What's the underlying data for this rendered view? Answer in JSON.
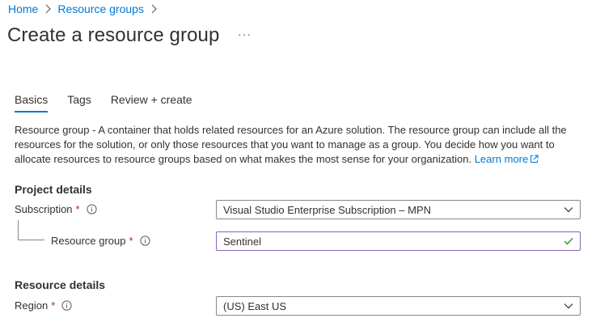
{
  "breadcrumb": {
    "items": [
      "Home",
      "Resource groups"
    ]
  },
  "title": "Create a resource group",
  "more_label": "···",
  "tabs": [
    {
      "label": "Basics",
      "active": true
    },
    {
      "label": "Tags",
      "active": false
    },
    {
      "label": "Review + create",
      "active": false
    }
  ],
  "description": {
    "term": "Resource group",
    "text": " - A container that holds related resources for an Azure solution. The resource group can include all the resources for the solution, or only those resources that you want to manage as a group. You decide how you want to allocate resources to resource groups based on what makes the most sense for your organization. ",
    "link": "Learn more"
  },
  "project_details": {
    "heading": "Project details",
    "subscription": {
      "label": "Subscription",
      "required": "*",
      "value": "Visual Studio Enterprise Subscription – MPN"
    },
    "resource_group": {
      "label": "Resource group",
      "required": "*",
      "value": "Sentinel"
    }
  },
  "resource_details": {
    "heading": "Resource details",
    "region": {
      "label": "Region",
      "required": "*",
      "value": "(US) East US"
    }
  },
  "colors": {
    "accent": "#0078d4",
    "required": "#a4262c",
    "valid": "#107c10",
    "focus_border": "#8764b8"
  },
  "icons": [
    "chevron-right-icon",
    "info-icon",
    "chevron-down-icon",
    "checkmark-icon",
    "external-link-icon"
  ]
}
